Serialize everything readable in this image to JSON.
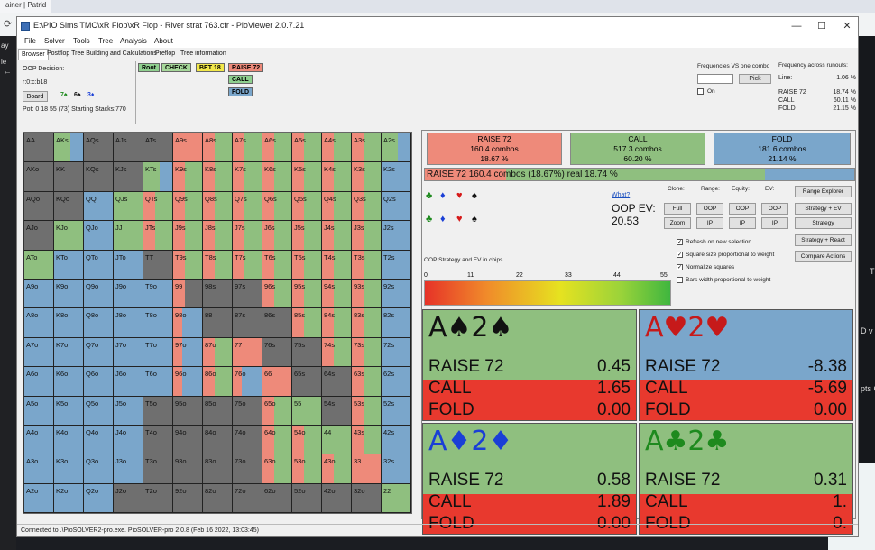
{
  "browser": {
    "tab_label": "ainer | Patrid",
    "left_texts": [
      "ay",
      "le"
    ],
    "right_texts": [
      "T",
      "D v E",
      "pts C"
    ]
  },
  "window": {
    "title": "E:\\PIO Sims TMC\\xR Flop\\xR Flop - River strat 763.cfr - PioViewer 2.0.7.21",
    "minimize": "—",
    "maximize": "☐",
    "close": "✕"
  },
  "menu": [
    "File",
    "Solver",
    "Tools",
    "Tree",
    "Analysis",
    "About"
  ],
  "tabs": [
    "Browser",
    "Postflop Tree Building and Calculations",
    "Preflop",
    "Tree information"
  ],
  "decision": {
    "title": "OOP Decision:",
    "line": "r:0:c:b18",
    "board_button": "Board",
    "board_cards": [
      {
        "text": "7♠",
        "color": "#1e8a1e"
      },
      {
        "text": "6♠",
        "color": "#111111"
      },
      {
        "text": "3♦",
        "color": "#1a3fd6"
      }
    ],
    "pot": "Pot: 0 18 55 (73) Starting Stacks:770"
  },
  "tree": [
    {
      "label": "Root",
      "bg": "#8fd08f"
    },
    {
      "label": "CHECK",
      "bg": "#a6d89a"
    },
    {
      "label": "BET 18",
      "bg": "#f2e84a"
    },
    {
      "label": "RAISE 72",
      "bg": "#ee8a7a"
    },
    {
      "label": "CALL",
      "bg": "#8fd08f"
    },
    {
      "label": "FOLD",
      "bg": "#7aa6cb"
    }
  ],
  "freq": {
    "title": "Frequencies VS one combo",
    "pick_button": "Pick",
    "on_label": "On",
    "runouts_title": "Frequency across runouts:",
    "rows": [
      {
        "label": "Line:",
        "value": "1.06 %"
      },
      {
        "label": "RAISE 72",
        "value": "18.74 %"
      },
      {
        "label": "CALL",
        "value": "60.11 %"
      },
      {
        "label": "FOLD",
        "value": "21.15 %"
      }
    ]
  },
  "ranks": [
    "A",
    "K",
    "Q",
    "J",
    "T",
    "9",
    "8",
    "7",
    "6",
    "5",
    "4",
    "3",
    "2"
  ],
  "grid_colors": {
    "raise": "#ee8a7a",
    "call": "#8fbf7f",
    "fold": "#7aa6cb",
    "empty": "#6f6f6f"
  },
  "grid": [
    [
      "AA",
      "AKs",
      "AQs",
      "AJs",
      "ATs",
      "A9s",
      "A8s",
      "A7s",
      "A6s",
      "A5s",
      "A4s",
      "A3s",
      "A2s"
    ],
    [
      "AKo",
      "KK",
      "KQs",
      "KJs",
      "KTs",
      "K9s",
      "K8s",
      "K7s",
      "K6s",
      "K5s",
      "K4s",
      "K3s",
      "K2s"
    ],
    [
      "AQo",
      "KQo",
      "QQ",
      "QJs",
      "QTs",
      "Q9s",
      "Q8s",
      "Q7s",
      "Q6s",
      "Q5s",
      "Q4s",
      "Q3s",
      "Q2s"
    ],
    [
      "AJo",
      "KJo",
      "QJo",
      "JJ",
      "JTs",
      "J9s",
      "J8s",
      "J7s",
      "J6s",
      "J5s",
      "J4s",
      "J3s",
      "J2s"
    ],
    [
      "ATo",
      "KTo",
      "QTo",
      "JTo",
      "TT",
      "T9s",
      "T8s",
      "T7s",
      "T6s",
      "T5s",
      "T4s",
      "T3s",
      "T2s"
    ],
    [
      "A9o",
      "K9o",
      "Q9o",
      "J9o",
      "T9o",
      "99",
      "98s",
      "97s",
      "96s",
      "95s",
      "94s",
      "93s",
      "92s"
    ],
    [
      "A8o",
      "K8o",
      "Q8o",
      "J8o",
      "T8o",
      "98o",
      "88",
      "87s",
      "86s",
      "85s",
      "84s",
      "83s",
      "82s"
    ],
    [
      "A7o",
      "K7o",
      "Q7o",
      "J7o",
      "T7o",
      "97o",
      "87o",
      "77",
      "76s",
      "75s",
      "74s",
      "73s",
      "72s"
    ],
    [
      "A6o",
      "K6o",
      "Q6o",
      "J6o",
      "T6o",
      "96o",
      "86o",
      "76o",
      "66",
      "65s",
      "64s",
      "63s",
      "62s"
    ],
    [
      "A5o",
      "K5o",
      "Q5o",
      "J5o",
      "T5o",
      "95o",
      "85o",
      "75o",
      "65o",
      "55",
      "54s",
      "53s",
      "52s"
    ],
    [
      "A4o",
      "K4o",
      "Q4o",
      "J4o",
      "T4o",
      "94o",
      "84o",
      "74o",
      "64o",
      "54o",
      "44",
      "43s",
      "42s"
    ],
    [
      "A3o",
      "K3o",
      "Q3o",
      "J3o",
      "T3o",
      "93o",
      "83o",
      "73o",
      "63o",
      "53o",
      "43o",
      "33",
      "32s"
    ],
    [
      "A2o",
      "K2o",
      "Q2o",
      "J2o",
      "T2o",
      "92o",
      "82o",
      "72o",
      "62o",
      "52o",
      "42o",
      "32o",
      "22"
    ]
  ],
  "grid_mix": [
    [
      "E",
      "CF",
      "E",
      "E",
      "E",
      "R",
      "RC",
      "RC",
      "RC",
      "RC",
      "RC",
      "RC",
      "CF"
    ],
    [
      "E",
      "E",
      "E",
      "E",
      "CF",
      "RC",
      "RC",
      "RC",
      "RC",
      "RC",
      "RC",
      "RC",
      "F"
    ],
    [
      "E",
      "E",
      "F",
      "C",
      "RC",
      "RC",
      "RC",
      "RC",
      "RC",
      "RC",
      "RC",
      "RC",
      "F"
    ],
    [
      "E",
      "C",
      "F",
      "C",
      "RC",
      "RC",
      "RC",
      "RC",
      "RC",
      "RC",
      "RC",
      "RC",
      "F"
    ],
    [
      "C",
      "F",
      "F",
      "F",
      "E",
      "RC",
      "RC",
      "RC",
      "RC",
      "RC",
      "RC",
      "RC",
      "F"
    ],
    [
      "F",
      "F",
      "F",
      "F",
      "F",
      "RE",
      "E",
      "E",
      "RC",
      "RC",
      "RC",
      "RC",
      "F"
    ],
    [
      "F",
      "F",
      "F",
      "F",
      "F",
      "RF",
      "E",
      "E",
      "E",
      "RC",
      "RC",
      "RC",
      "F"
    ],
    [
      "F",
      "F",
      "F",
      "F",
      "F",
      "RF",
      "RC",
      "R",
      "E",
      "E",
      "RC",
      "RC",
      "F"
    ],
    [
      "F",
      "F",
      "F",
      "F",
      "F",
      "RF",
      "RC",
      "RF",
      "R",
      "E",
      "E",
      "RC",
      "F"
    ],
    [
      "F",
      "F",
      "F",
      "F",
      "E",
      "E",
      "E",
      "E",
      "RC",
      "C",
      "E",
      "RC",
      "F"
    ],
    [
      "F",
      "F",
      "F",
      "F",
      "E",
      "E",
      "E",
      "E",
      "RC",
      "RC",
      "C",
      "RC",
      "F"
    ],
    [
      "F",
      "F",
      "F",
      "F",
      "E",
      "E",
      "E",
      "E",
      "RC",
      "RC",
      "RC",
      "R",
      "F"
    ],
    [
      "F",
      "F",
      "F",
      "E",
      "E",
      "E",
      "E",
      "E",
      "E",
      "E",
      "E",
      "E",
      "C"
    ]
  ],
  "actions": [
    {
      "name": "RAISE 72",
      "combos": "160.4 combos",
      "pct": "18.67 %",
      "bg": "#ee8a7a"
    },
    {
      "name": "CALL",
      "combos": "517.3 combos",
      "pct": "60.20 %",
      "bg": "#8fbf7f"
    },
    {
      "name": "FOLD",
      "combos": "181.6 combos",
      "pct": "21.14 %",
      "bg": "#7aa6cb"
    }
  ],
  "info_bar": {
    "text": "RAISE 72   160.4 combos (18.67%) real  18.74 %",
    "raise_frac": 0.1874,
    "call_frac": 0.6011
  },
  "hand_suits": {
    "row1": [
      {
        "s": "♣",
        "c": "#1e8a1e"
      },
      {
        "s": "♦",
        "c": "#1a3fd6"
      },
      {
        "s": "♥",
        "c": "#d61a1a"
      },
      {
        "s": "♠",
        "c": "#111"
      }
    ],
    "row2": [
      {
        "s": "♣",
        "c": "#1e8a1e"
      },
      {
        "s": "♦",
        "c": "#1a3fd6"
      },
      {
        "s": "♥",
        "c": "#d61a1a"
      },
      {
        "s": "♠",
        "c": "#111"
      }
    ]
  },
  "ev": {
    "what_link": "What?",
    "label": "OOP EV:",
    "value": "20.53"
  },
  "controls": {
    "clone_label": "Clone:",
    "range_label": "Range:",
    "equity_label": "Equity:",
    "ev_label": "EV:",
    "full": "Full",
    "zoom": "Zoom",
    "oop1": "OOP",
    "ip1": "IP",
    "oop2": "OOP",
    "ip2": "IP",
    "oop3": "OOP",
    "ip3": "IP",
    "range_explorer": "Range Explorer",
    "strategy_ev": "Strategy + EV",
    "strategy": "Strategy",
    "strategy_react": "Strategy + React",
    "compare_actions": "Compare Actions"
  },
  "checkboxes": [
    "Refresh on new selection",
    "Square size proportional to weight",
    "Normalize squares",
    "Bars width proportional to weight"
  ],
  "scale_label": "OOP Strategy and EV in chips",
  "scale_ticks": [
    "0",
    "11",
    "22",
    "33",
    "44",
    "55"
  ],
  "combos": [
    {
      "hand": "A♠2♠",
      "hand_color": "#111111",
      "rows": [
        {
          "a": "RAISE 72",
          "v": "0.45"
        },
        {
          "a": "CALL",
          "v": "1.65"
        },
        {
          "a": "FOLD",
          "v": "0.00"
        }
      ],
      "top_bg": "#8fbf7f"
    },
    {
      "hand": "A♥2♥",
      "hand_color": "#c61a1a",
      "rows": [
        {
          "a": "RAISE 72",
          "v": "-8.38"
        },
        {
          "a": "CALL",
          "v": "-5.69"
        },
        {
          "a": "FOLD",
          "v": "0.00"
        }
      ],
      "top_bg": "#7aa6cb"
    },
    {
      "hand": "A♦2♦",
      "hand_color": "#1a3fd6",
      "rows": [
        {
          "a": "RAISE 72",
          "v": "0.58"
        },
        {
          "a": "CALL",
          "v": "1.89"
        },
        {
          "a": "FOLD",
          "v": "0.00"
        }
      ],
      "top_bg": "#8fbf7f"
    },
    {
      "hand": "A♣2♣",
      "hand_color": "#1e8a1e",
      "rows": [
        {
          "a": "RAISE 72",
          "v": "0.31"
        },
        {
          "a": "CALL",
          "v": "1."
        },
        {
          "a": "FOLD",
          "v": "0."
        }
      ],
      "top_bg": "#8fbf7f"
    }
  ],
  "status": "Connected to .\\PioSOLVER2-pro.exe. PioSOLVER-pro 2.0.8 (Feb 16 2022, 13:03:45)"
}
